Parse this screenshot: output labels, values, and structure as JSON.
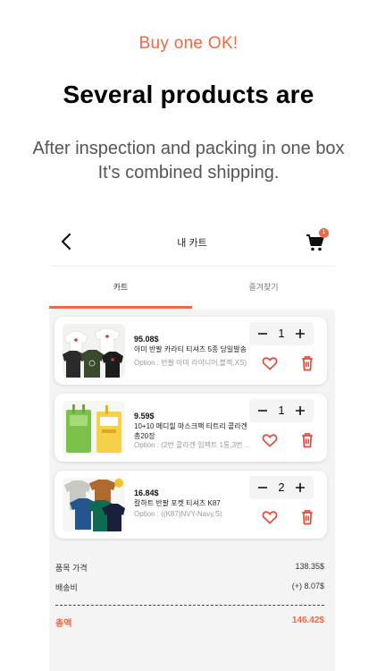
{
  "promo": {
    "kicker": "Buy one OK!",
    "headline": "Several products are",
    "sub_line1": "After inspection and packing in one box",
    "sub_line2": "It's combined shipping."
  },
  "app": {
    "title": "내 카트",
    "cart_badge": "1",
    "accent_color": "#ee6a44"
  },
  "tabs": [
    {
      "label": "카트",
      "active": true
    },
    {
      "label": "즐겨찾기",
      "active": false
    }
  ],
  "cart_items": [
    {
      "price": "95.08$",
      "name": "아미 반팔 카라티 티셔츠 5종 당일발송",
      "option": "Option : 반팔 아미 라이니어,블랙,XS)",
      "qty": "1"
    },
    {
      "price": "9.59$",
      "name": "10+10 메디힐 마스크팩 티트리 콜라겐 총20장",
      "option": "Option : (2번 콜라겐 임팩트 1통,3번 ...",
      "qty": "1"
    },
    {
      "price": "16.84$",
      "name": "칼하트 반팔 포켓 티셔츠 K87",
      "option": "Option : ((K87)NVY-Navy,S)",
      "qty": "2"
    }
  ],
  "summary": {
    "item_price_label": "품목 가격",
    "item_price_value": "138.35$",
    "shipping_label": "배송비",
    "shipping_value": "(+) 8.07$",
    "total_label": "총액",
    "total_value": "146.42$"
  },
  "icons": {
    "back": "chevron-left-icon",
    "cart": "shopping-cart-icon",
    "minus": "minus-icon",
    "plus": "plus-icon",
    "heart": "heart-outline-icon",
    "trash": "trash-icon"
  }
}
